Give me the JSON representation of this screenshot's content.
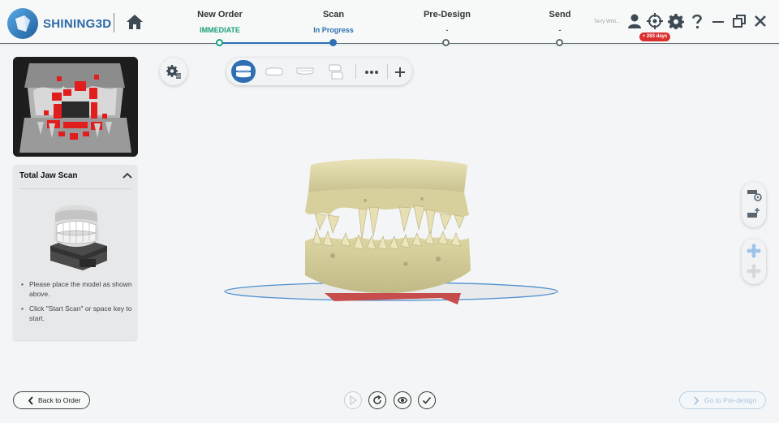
{
  "app": {
    "logo_text": "SHINING3D"
  },
  "steps": [
    {
      "title": "New Order",
      "status": "IMMEDIATE",
      "status_color": "#1aa07a"
    },
    {
      "title": "Scan",
      "status": "In Progress",
      "status_color": "#2b6fb0"
    },
    {
      "title": "Pre-Design",
      "status": "-",
      "status_color": "#555555"
    },
    {
      "title": "Send",
      "status": "-",
      "status_color": "#555555"
    }
  ],
  "user": {
    "name": "Terry Whit...",
    "license_badge": "+ 283 days"
  },
  "header_icons": [
    "user-icon",
    "target-icon",
    "gear-icon",
    "help-icon",
    "minimize-icon",
    "restore-icon",
    "close-icon"
  ],
  "scan_panel": {
    "title": "Total Jaw Scan",
    "instructions": [
      "Please place the model as shown above.",
      "Click \"Start Scan\" or space key to start."
    ]
  },
  "toolbar": {
    "items": [
      "total-jaw-mode-icon",
      "upper-jaw-mode-icon",
      "lower-jaw-mode-icon",
      "bite-mode-icon",
      "more-icon",
      "add-icon"
    ]
  },
  "footer": {
    "back_label": "Back to Order",
    "next_label": "Go to Pre-design"
  },
  "colors": {
    "accent": "#2e6fb3",
    "badge_red": "#d93030",
    "model": "#dcd6a6"
  }
}
